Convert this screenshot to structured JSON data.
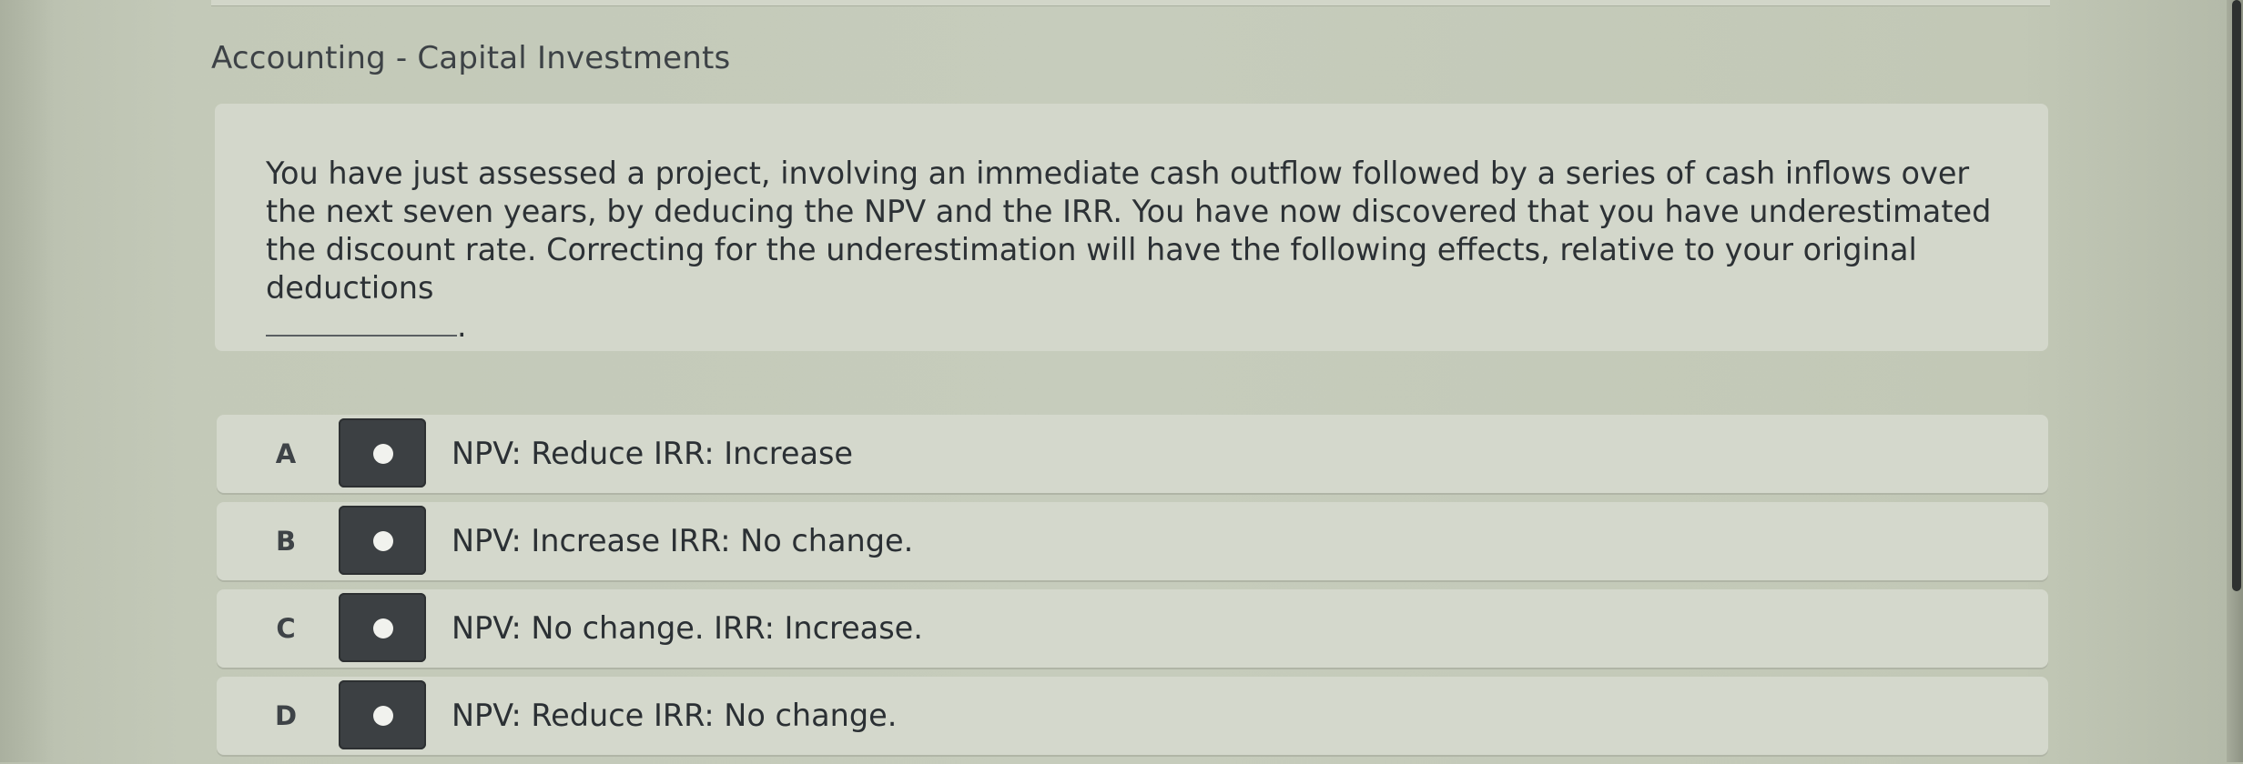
{
  "header": {
    "title": "Accounting - Capital Investments"
  },
  "question": {
    "text": "You have just assessed a project, involving an immediate cash outflow followed by a series of cash inflows over the next seven years, by deducing the NPV and the IRR. You have now discovered that you have underestimated the discount rate. Correcting for the underestimation will have the following effects, relative to your original deductions",
    "end_punctuation": "."
  },
  "options": [
    {
      "letter": "A",
      "text": "NPV: Reduce IRR: Increase"
    },
    {
      "letter": "B",
      "text": "NPV: Increase IRR: No change."
    },
    {
      "letter": "C",
      "text": "NPV: No change. IRR: Increase."
    },
    {
      "letter": "D",
      "text": "NPV: Reduce IRR: No change."
    }
  ],
  "colors": {
    "background": "#c6ccbc",
    "card": "#d4d8cc",
    "radio": "#3c4043",
    "text": "#2c3135"
  }
}
